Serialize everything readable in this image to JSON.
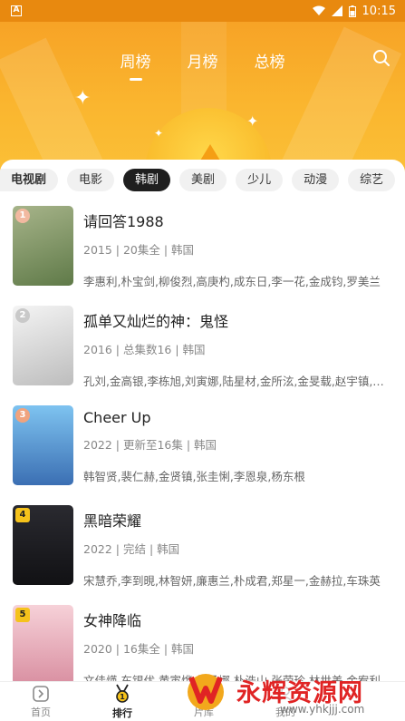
{
  "status": {
    "time": "10:15",
    "app_icon": "A"
  },
  "header": {
    "tabs": [
      {
        "label": "周榜",
        "active": true
      },
      {
        "label": "月榜",
        "active": false
      },
      {
        "label": "总榜",
        "active": false
      }
    ],
    "search_icon": "search-icon",
    "bg_color": "#F7A326"
  },
  "categories": [
    {
      "label": "电视剧"
    },
    {
      "label": "电影"
    },
    {
      "label": "韩剧",
      "active": true
    },
    {
      "label": "美剧"
    },
    {
      "label": "少儿"
    },
    {
      "label": "动漫"
    },
    {
      "label": "综艺"
    }
  ],
  "items": [
    {
      "rank": "1",
      "title": "请回答1988",
      "meta": "2015 | 20集全 | 韩国",
      "cast": "李惠利,朴宝剑,柳俊烈,高庚杓,成东日,李一花,金成钧,罗美兰",
      "poster_color": "#7C9A5C"
    },
    {
      "rank": "2",
      "title": "孤单又灿烂的神：鬼怪",
      "meta": "2016 | 总集数16 | 韩国",
      "cast": "孔刘,金高银,李栋旭,刘寅娜,陆星材,金所泫,金旻载,赵宇镇,金炳哲",
      "poster_color": "#D9D9D9"
    },
    {
      "rank": "3",
      "title": "Cheer Up",
      "meta": "2022 | 更新至16集 | 韩国",
      "cast": "韩智贤,裴仁赫,金贤镇,张圭悧,李恩泉,杨东根",
      "poster_color": "#4F8FD1"
    },
    {
      "rank": "4",
      "title": "黑暗荣耀",
      "meta": "2022 | 完结 | 韩国",
      "cast": "宋慧乔,李到晛,林智妍,廉惠兰,朴成君,郑星一,金赫拉,车珠英",
      "poster_color": "#1B1B1F"
    },
    {
      "rank": "5",
      "title": "女神降临",
      "meta": "2020 | 16集全 | 韩国",
      "cast": "文佳煐,车银优,黄寅烨,朴柔娜,朴浩山,张荣珍,林世美,金宥利",
      "poster_color": "#E7A9B6"
    }
  ],
  "nav": [
    {
      "label": "首页",
      "active": false
    },
    {
      "label": "排行",
      "active": true
    },
    {
      "label": "片库",
      "active": false
    },
    {
      "label": "我的",
      "active": false
    }
  ],
  "watermark": {
    "text": "永辉资源网",
    "url": "www.yhkjjj.com"
  }
}
